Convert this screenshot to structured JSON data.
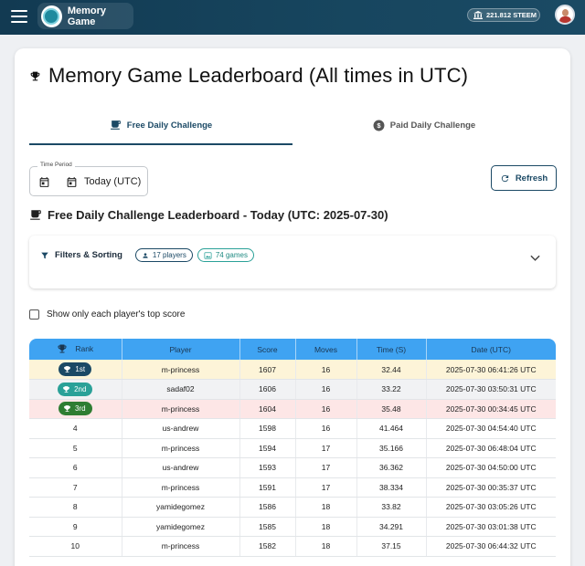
{
  "app": {
    "name": "Memory Game"
  },
  "wallet": {
    "balance": "221.812 STEEM"
  },
  "page": {
    "title": "Memory Game Leaderboard (All times in UTC)"
  },
  "tabs": [
    {
      "label": "Free Daily Challenge",
      "active": true,
      "icon": "coffee-cup-icon"
    },
    {
      "label": "Paid Daily Challenge",
      "active": false,
      "icon": "dollar-coin-icon"
    }
  ],
  "time_period": {
    "label": "Time Period",
    "value": "Today (UTC)"
  },
  "refresh": {
    "label": "Refresh"
  },
  "board": {
    "title": "Free Daily Challenge Leaderboard - Today (UTC: 2025-07-30)"
  },
  "filters": {
    "label": "Filters & Sorting",
    "players_chip": "17 players",
    "games_chip": "74 games"
  },
  "top_score_toggle": {
    "label": "Show only each player's top score",
    "checked": false
  },
  "table": {
    "headers": [
      "Rank",
      "Player",
      "Score",
      "Moves",
      "Time (S)",
      "Date (UTC)"
    ],
    "rows": [
      {
        "rank": "1st",
        "player": "m-princess",
        "score": "1607",
        "moves": "16",
        "time": "32.44",
        "date": "2025-07-30 06:41:26 UTC"
      },
      {
        "rank": "2nd",
        "player": "sadaf02",
        "score": "1606",
        "moves": "16",
        "time": "33.22",
        "date": "2025-07-30 03:50:31 UTC"
      },
      {
        "rank": "3rd",
        "player": "m-princess",
        "score": "1604",
        "moves": "16",
        "time": "35.48",
        "date": "2025-07-30 00:34:45 UTC"
      },
      {
        "rank": "4",
        "player": "us-andrew",
        "score": "1598",
        "moves": "16",
        "time": "41.464",
        "date": "2025-07-30 04:54:40 UTC"
      },
      {
        "rank": "5",
        "player": "m-princess",
        "score": "1594",
        "moves": "17",
        "time": "35.166",
        "date": "2025-07-30 06:48:04 UTC"
      },
      {
        "rank": "6",
        "player": "us-andrew",
        "score": "1593",
        "moves": "17",
        "time": "36.362",
        "date": "2025-07-30 04:50:00 UTC"
      },
      {
        "rank": "7",
        "player": "m-princess",
        "score": "1591",
        "moves": "17",
        "time": "38.334",
        "date": "2025-07-30 00:35:37 UTC"
      },
      {
        "rank": "8",
        "player": "yamidegomez",
        "score": "1586",
        "moves": "18",
        "time": "33.82",
        "date": "2025-07-30 03:05:26 UTC"
      },
      {
        "rank": "9",
        "player": "yamidegomez",
        "score": "1585",
        "moves": "18",
        "time": "34.291",
        "date": "2025-07-30 03:01:38 UTC"
      },
      {
        "rank": "10",
        "player": "m-princess",
        "score": "1582",
        "moves": "18",
        "time": "37.15",
        "date": "2025-07-30 06:44:32 UTC"
      }
    ]
  },
  "colors": {
    "appbar": "#123a52",
    "primary": "#1b4965",
    "table_header": "#3fa3f2",
    "gold_badge": "#1b4965",
    "silver_badge": "#2aa198",
    "bronze_badge": "#2e7d32",
    "row_gold": "#fdf4d8",
    "row_silver": "#f1f2f4",
    "row_bronze": "#fde6e6"
  }
}
